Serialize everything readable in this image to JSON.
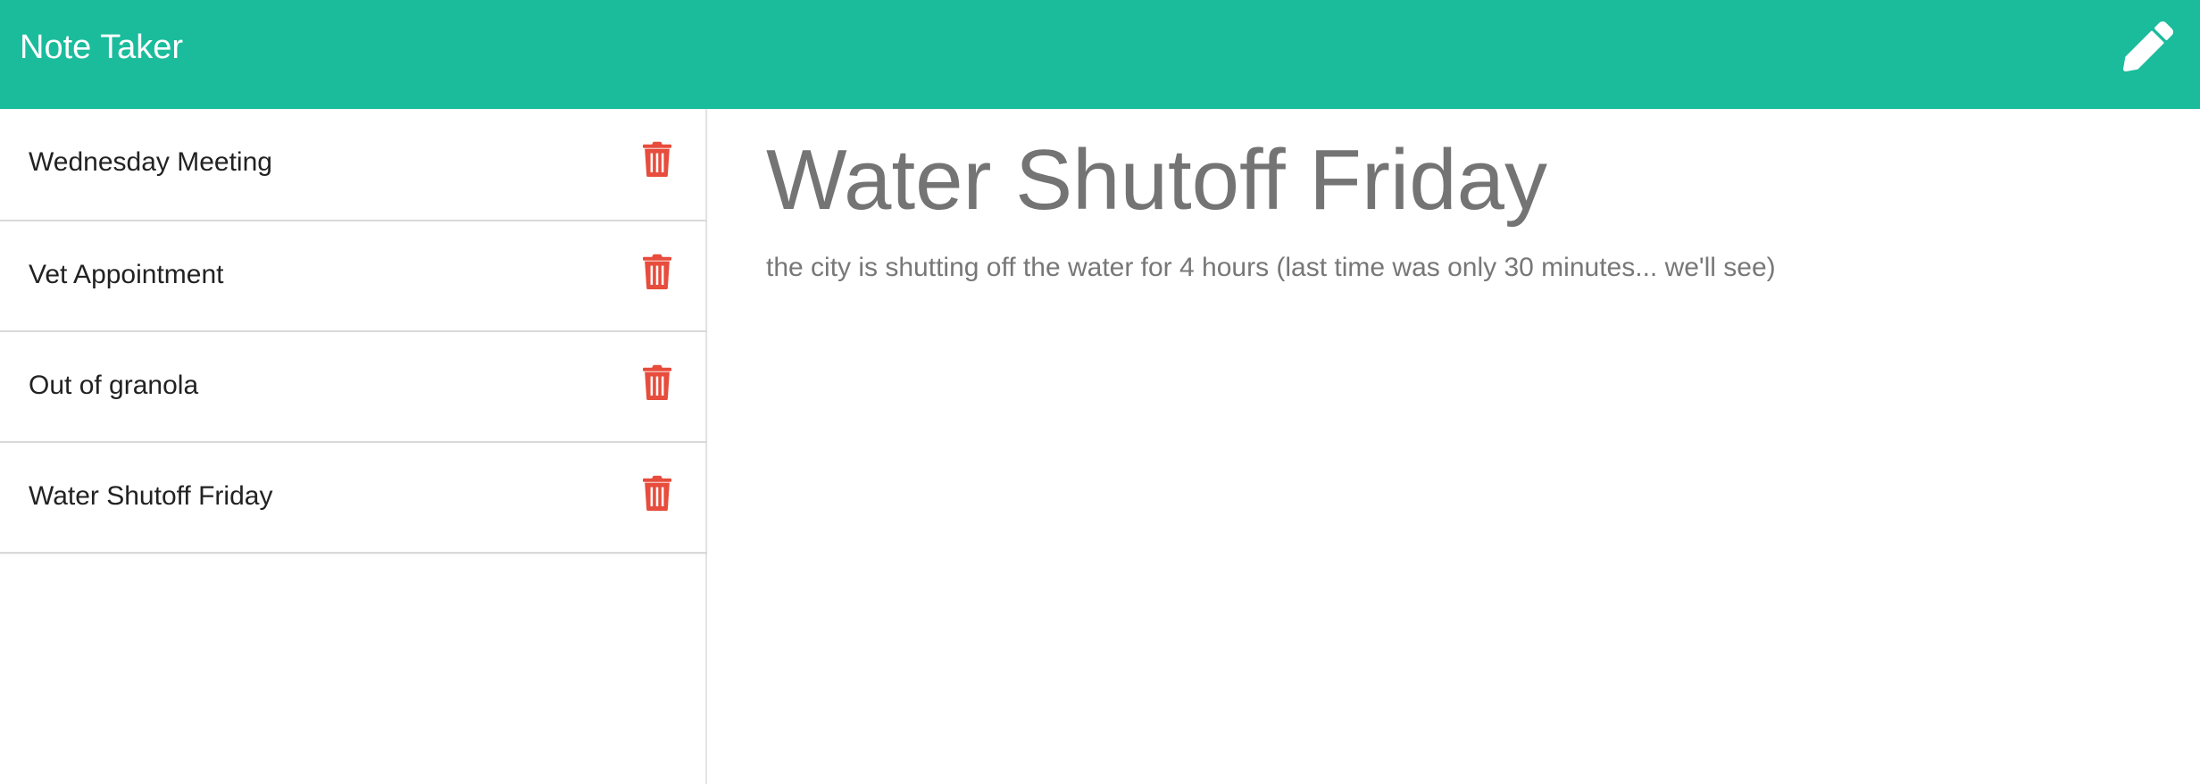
{
  "app": {
    "title": "Note Taker"
  },
  "toolbar": {
    "new_note_icon": "pencil-icon"
  },
  "sidebar": {
    "items": [
      {
        "title": "Wednesday Meeting",
        "delete_icon": "trash-icon"
      },
      {
        "title": "Vet Appointment",
        "delete_icon": "trash-icon"
      },
      {
        "title": "Out of granola",
        "delete_icon": "trash-icon"
      },
      {
        "title": "Water Shutoff Friday",
        "delete_icon": "trash-icon"
      }
    ]
  },
  "active_note": {
    "title": "Water Shutoff Friday",
    "text": "the city is shutting off the water for 4 hours (last time was only 30 minutes... we'll see)"
  },
  "colors": {
    "navbar": "#1abc9c",
    "delete": "#e74c3c",
    "note_text": "#777777"
  }
}
